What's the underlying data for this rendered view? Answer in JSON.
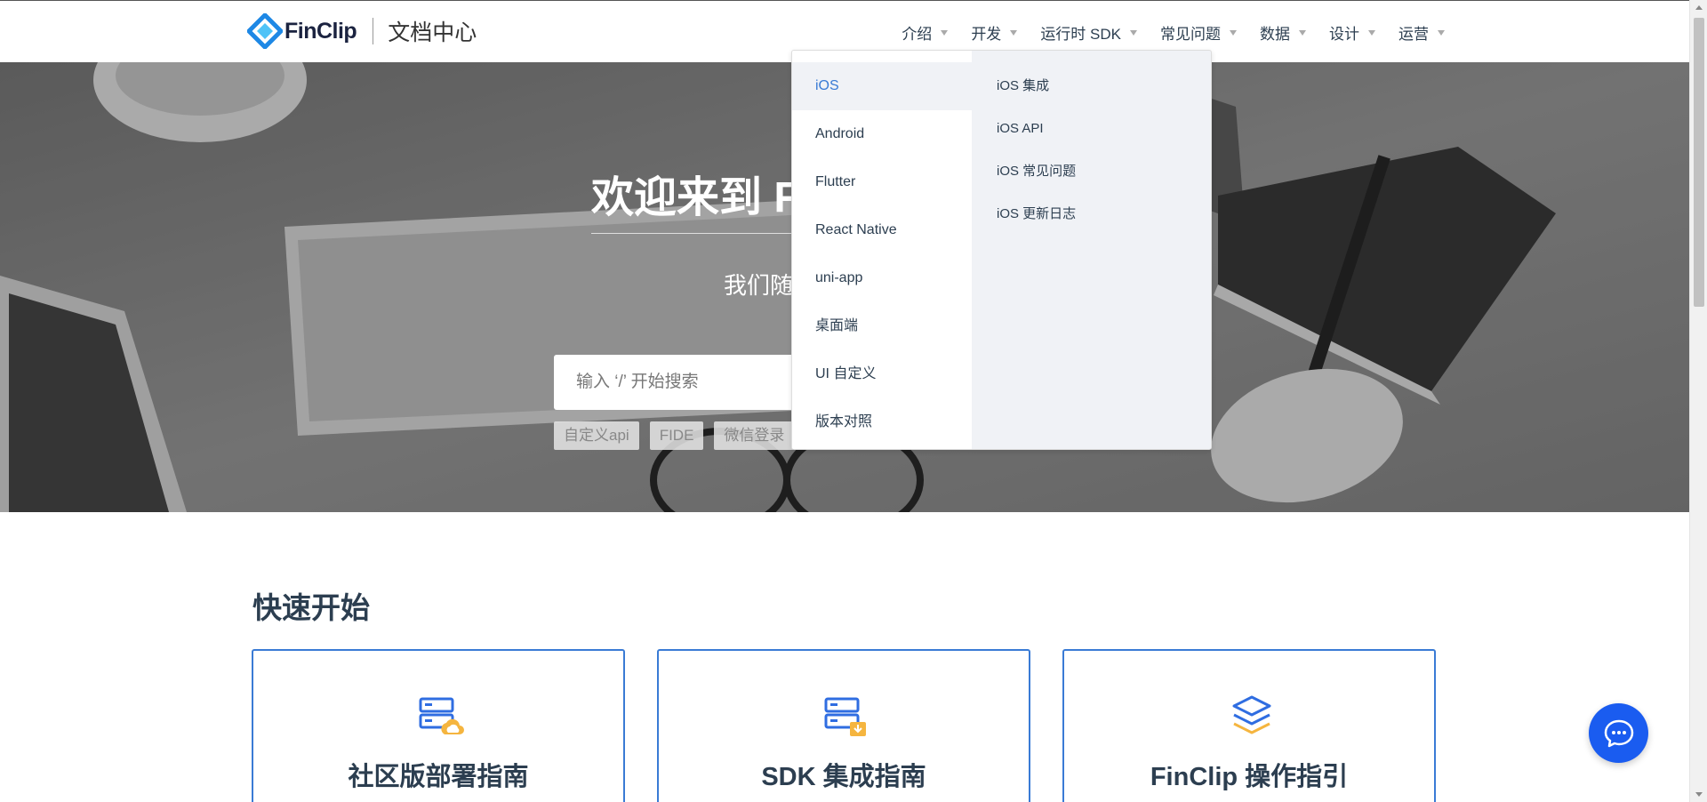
{
  "brand": {
    "name": "FinClip",
    "subtitle": "文档中心",
    "logo_icon": "finclip-logo-icon",
    "brand_color": "#1e88e5"
  },
  "nav": {
    "items": [
      {
        "label": "介绍"
      },
      {
        "label": "开发"
      },
      {
        "label": "运行时 SDK"
      },
      {
        "label": "常见问题"
      },
      {
        "label": "数据"
      },
      {
        "label": "设计"
      },
      {
        "label": "运营"
      }
    ]
  },
  "dropdown": {
    "left_items": [
      {
        "label": "iOS",
        "active": true
      },
      {
        "label": "Android"
      },
      {
        "label": "Flutter"
      },
      {
        "label": "React Native"
      },
      {
        "label": "uni-app"
      },
      {
        "label": "桌面端"
      },
      {
        "label": "UI 自定义"
      },
      {
        "label": "版本对照"
      }
    ],
    "right_items": [
      {
        "label": "iOS 集成"
      },
      {
        "label": "iOS API"
      },
      {
        "label": "iOS 常见问题"
      },
      {
        "label": "iOS 更新日志"
      }
    ]
  },
  "hero": {
    "title": "欢迎来到 F",
    "subtitle": "我们随",
    "search_placeholder": "输入 ‘/’ 开始搜索",
    "tags": [
      "自定义api",
      "FIDE",
      "微信登录"
    ]
  },
  "quick_start": {
    "title": "快速开始",
    "cards": [
      {
        "title": "社区版部署指南",
        "icon": "server-cloud-icon"
      },
      {
        "title": "SDK 集成指南",
        "icon": "server-download-icon"
      },
      {
        "title": "FinClip 操作指引",
        "icon": "layers-icon"
      }
    ]
  },
  "colors": {
    "accent": "#3a7bd5",
    "fab": "#1a5cf0",
    "icon_blue": "#2f6de1",
    "icon_orange": "#f5b53f"
  },
  "chat": {
    "icon": "chat-bubble-icon"
  }
}
